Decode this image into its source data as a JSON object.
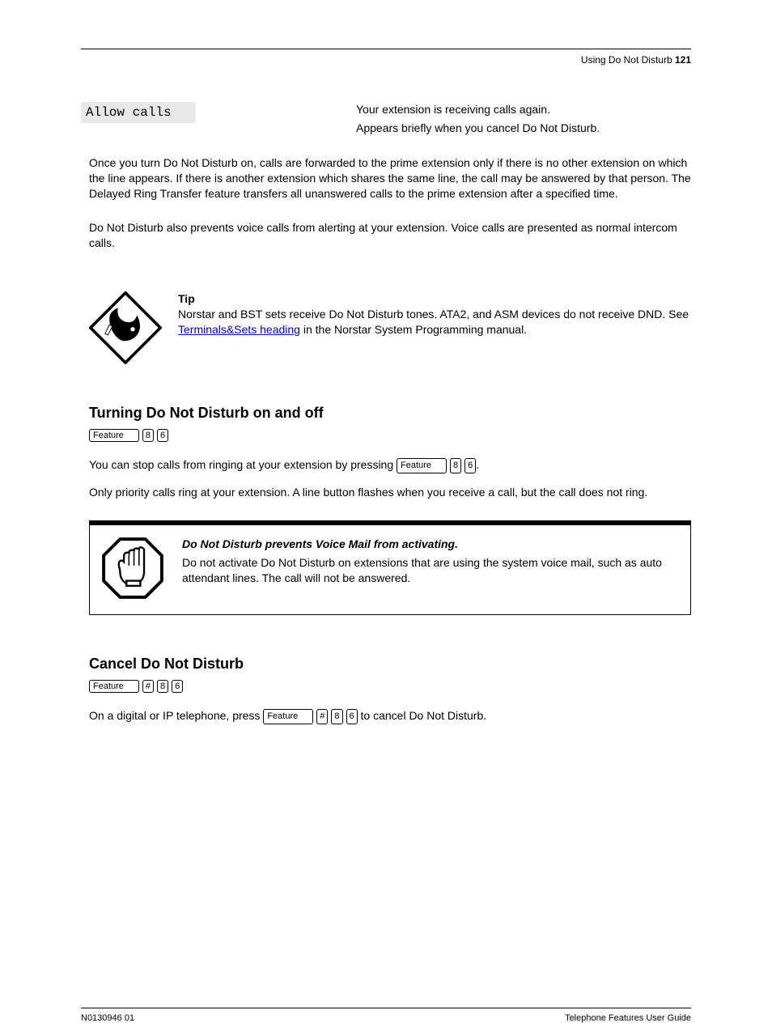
{
  "header": {
    "left": "",
    "right_prefix": "Using Do Not Disturb  ",
    "page_num": "121"
  },
  "lcd": {
    "label": "Allow calls"
  },
  "desc": {
    "p1": "Your extension is receiving calls again.",
    "p2": "Appears briefly when you cancel Do Not Disturb."
  },
  "para1": "Once you turn Do Not Disturb on, calls are forwarded to the prime extension only if there is no other extension on which the line appears. If there is another extension which shares the same line, the call may be answered by that person. The Delayed Ring Transfer feature transfers all unanswered calls to the prime extension after a specified time.",
  "para2": "Do Not Disturb also prevents voice calls from alerting at your extension. Voice calls are presented as normal intercom calls.",
  "tip": {
    "title": "Tip",
    "body_pre": "Norstar and BST sets receive Do Not Disturb tones. ATA2, and ASM devices do not receive DND. See ",
    "link": "Terminals&Sets heading",
    "body_post": " in the Norstar System Programming manual."
  },
  "section_drt": {
    "title": "Turning Do Not Disturb on and off ",
    "keys": [
      "Feature",
      "8",
      "6"
    ],
    "body_pre": "You can stop calls from ringing at your extension by pressing ",
    "body_post": ".",
    "body2": "Only priority calls ring at your extension. A line button flashes when you receive a call, but the call does not ring."
  },
  "warning": {
    "title": "Do Not Disturb prevents Voice Mail from activating.",
    "body": "Do not activate Do Not Disturb on extensions that are using the system voice mail, such as auto attendant lines. The call will not be answered."
  },
  "section_cancel": {
    "title": "Cancel Do Not Disturb",
    "keys": [
      "Feature",
      "#",
      "8",
      "6"
    ],
    "body_pre": "On a digital or IP telephone, press ",
    "body_post": " to cancel Do Not Disturb."
  },
  "footer": {
    "left": "N0130946 01",
    "right": "Telephone Features User Guide"
  }
}
